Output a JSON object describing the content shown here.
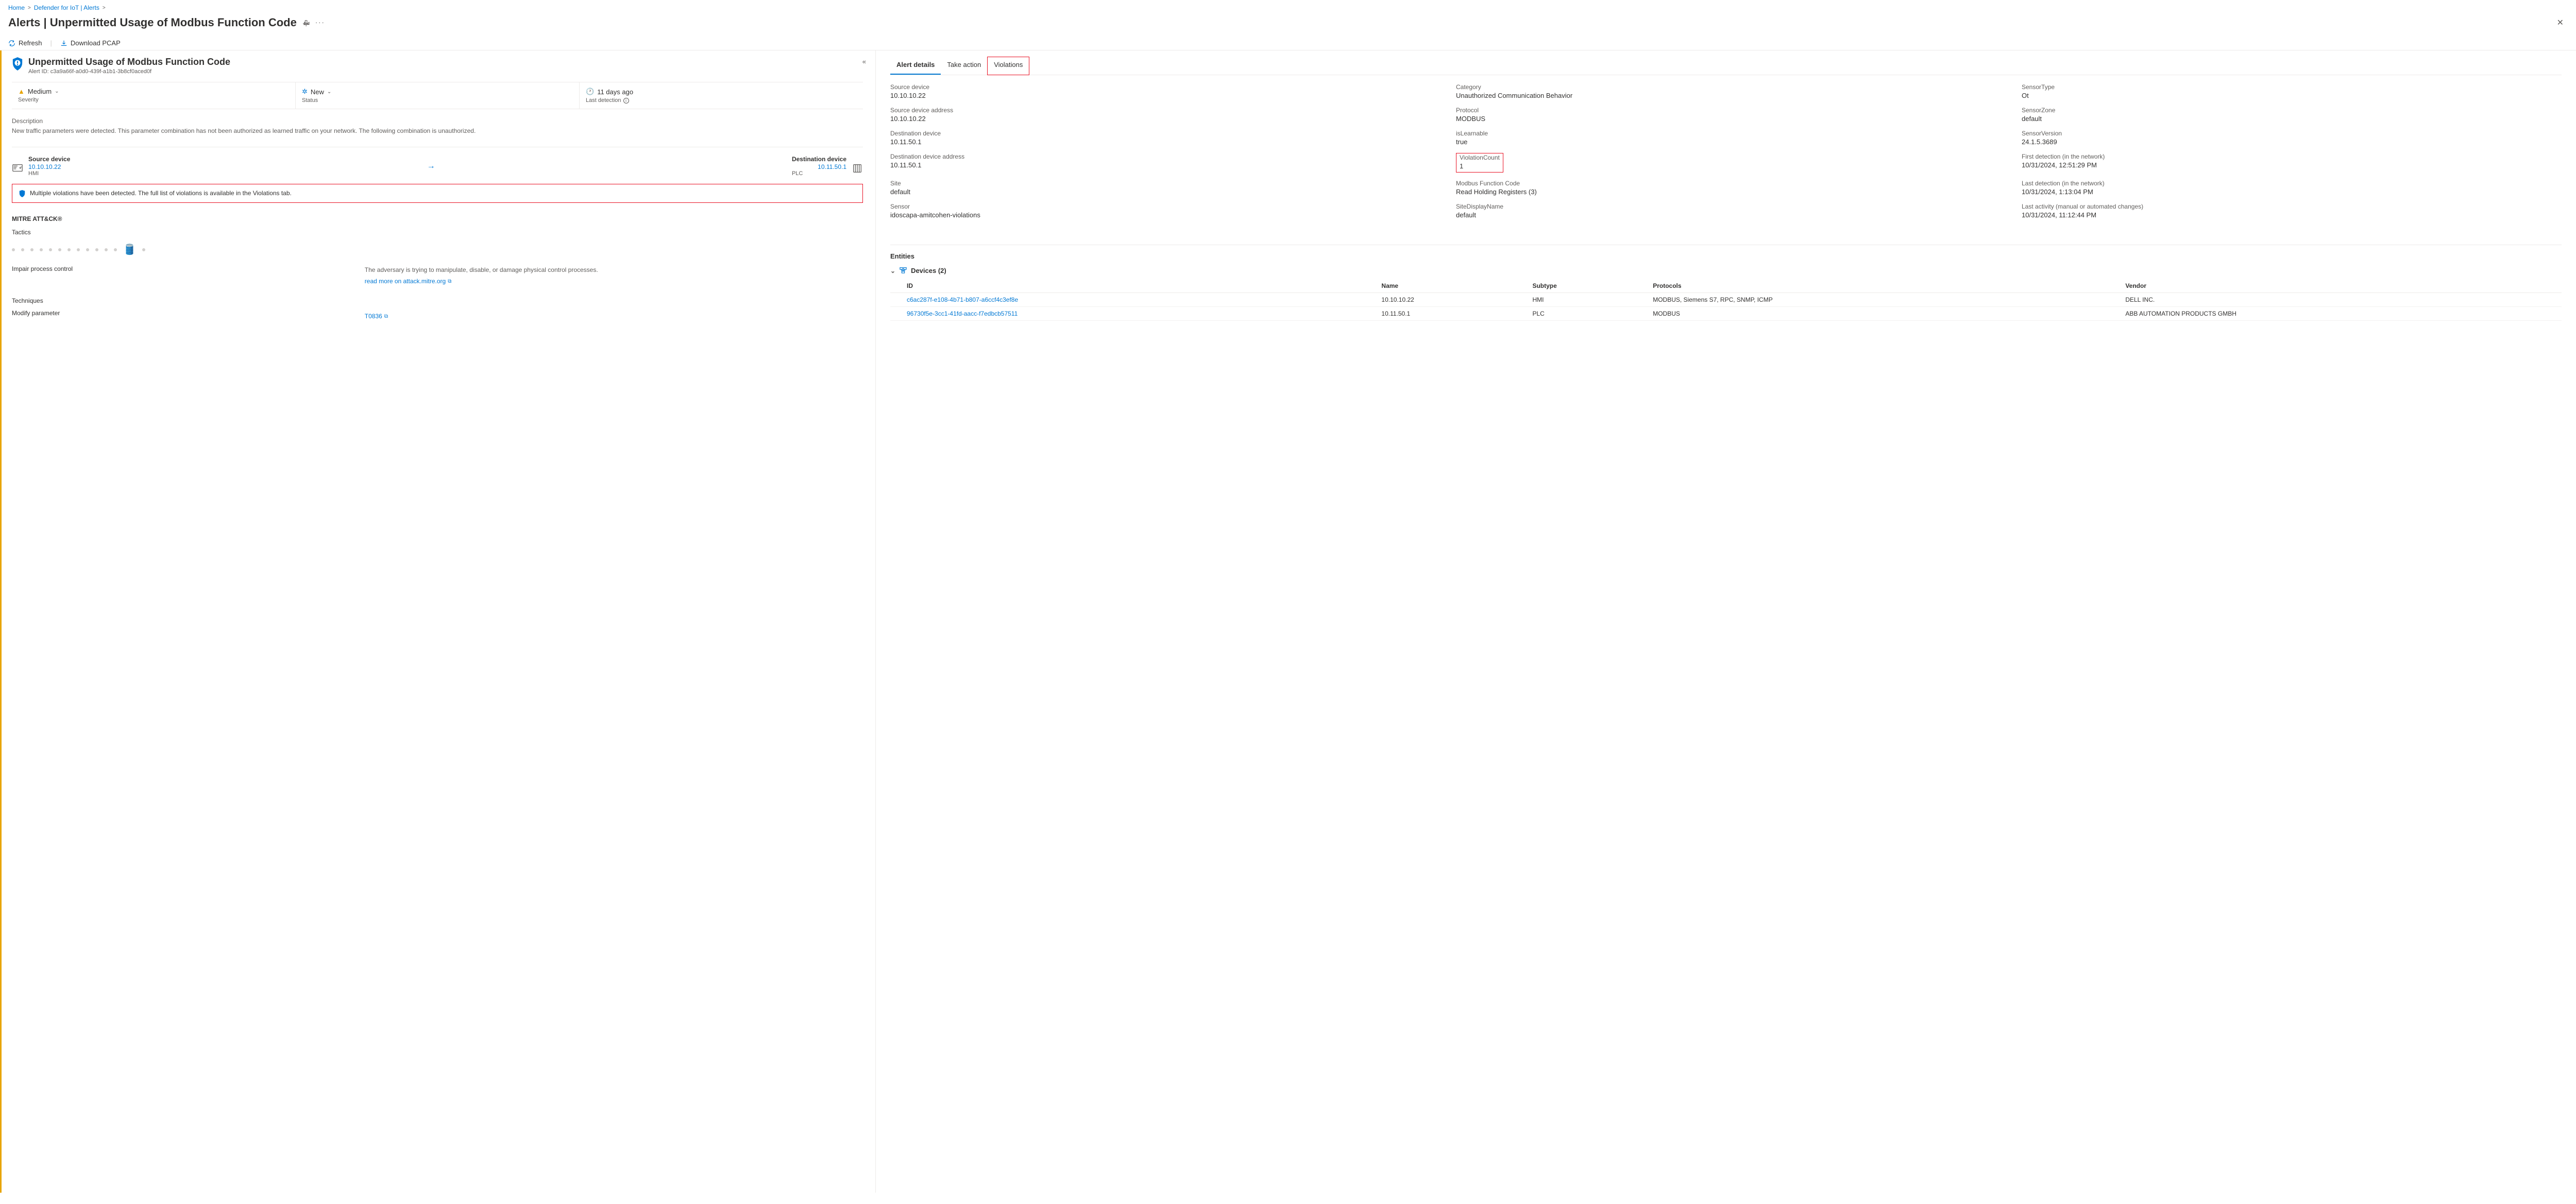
{
  "breadcrumb": {
    "items": [
      "Home",
      "Defender for IoT | Alerts"
    ]
  },
  "page": {
    "title": "Alerts | Unpermitted Usage of Modbus Function Code"
  },
  "commands": {
    "refresh": "Refresh",
    "download": "Download PCAP"
  },
  "left": {
    "title": "Unpermitted Usage of Modbus Function Code",
    "alert_id_label": "Alert ID:",
    "alert_id": "c3a9a66f-a0d0-439f-a1b1-3b8cf0aced0f",
    "severity_value": "Medium",
    "severity_label": "Severity",
    "status_value": "New",
    "status_label": "Status",
    "detection_value": "11 days ago",
    "detection_label": "Last detection",
    "description_label": "Description",
    "description": "New traffic parameters were detected. This parameter combination has not been authorized as learned traffic on your network. The following combination is unauthorized.",
    "source_device_label": "Source device",
    "source_ip": "10.10.10.22",
    "source_type": "HMI",
    "destination_device_label": "Destination device",
    "dest_ip": "10.11.50.1",
    "dest_type": "PLC",
    "warn_box": "Multiple violations have been detected. The full list of violations is available in the Violations tab.",
    "mitre_title": "MITRE ATT&CK®",
    "tactics_label": "Tactics",
    "tactic_name": "Impair process control",
    "tactic_desc": "The adversary is trying to manipulate, disable, or damage physical control processes.",
    "tactic_link": "read more on attack.mitre.org",
    "techniques_label": "Techniques",
    "technique_name": "Modify parameter",
    "technique_id": "T0836"
  },
  "tabs": {
    "details": "Alert details",
    "action": "Take action",
    "violations": "Violations"
  },
  "details": {
    "c1": [
      {
        "k": "Source device",
        "v": "10.10.10.22"
      },
      {
        "k": "Source device address",
        "v": "10.10.10.22"
      },
      {
        "k": "Destination device",
        "v": "10.11.50.1"
      },
      {
        "k": "Destination device address",
        "v": "10.11.50.1"
      },
      {
        "k": "Site",
        "v": "default"
      },
      {
        "k": "Sensor",
        "v": "idoscapa-amitcohen-violations"
      }
    ],
    "c2": [
      {
        "k": "Category",
        "v": "Unauthorized Communication Behavior"
      },
      {
        "k": "Protocol",
        "v": "MODBUS"
      },
      {
        "k": "isLearnable",
        "v": "true"
      },
      {
        "k": "ViolationCount",
        "v": "1",
        "boxed": true
      },
      {
        "k": "Modbus Function Code",
        "v": "Read Holding Registers (3)"
      },
      {
        "k": "SiteDisplayName",
        "v": "default"
      }
    ],
    "c3": [
      {
        "k": "SensorType",
        "v": "Ot"
      },
      {
        "k": "SensorZone",
        "v": "default"
      },
      {
        "k": "SensorVersion",
        "v": "24.1.5.3689"
      },
      {
        "k": "First detection (in the network)",
        "v": "10/31/2024, 12:51:29 PM"
      },
      {
        "k": "Last detection (in the network)",
        "v": "10/31/2024, 1:13:04 PM"
      },
      {
        "k": "Last activity (manual or automated changes)",
        "v": "10/31/2024, 11:12:44 PM"
      }
    ]
  },
  "entities": {
    "title": "Entities",
    "group": "Devices (2)",
    "headers": [
      "ID",
      "Name",
      "Subtype",
      "Protocols",
      "Vendor"
    ],
    "rows": [
      {
        "id": "c6ac287f-e108-4b71-b807-a6ccf4c3ef8e",
        "name": "10.10.10.22",
        "subtype": "HMI",
        "protocols": "MODBUS, Siemens S7, RPC, SNMP, ICMP",
        "vendor": "DELL INC."
      },
      {
        "id": "96730f5e-3cc1-41fd-aacc-f7edbcb57511",
        "name": "10.11.50.1",
        "subtype": "PLC",
        "protocols": "MODBUS",
        "vendor": "ABB AUTOMATION PRODUCTS GMBH"
      }
    ]
  }
}
